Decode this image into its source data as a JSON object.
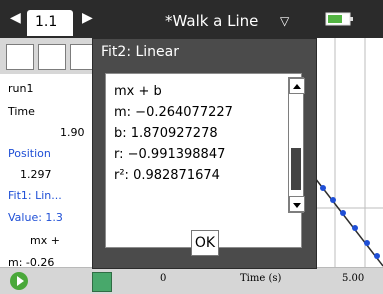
{
  "app": {
    "tab_label": "1.1",
    "title": "*Walk a Line"
  },
  "left_panel": {
    "run": "run1",
    "time_label": "Time",
    "time_value": "1.90",
    "position_label": "Position",
    "position_value": "1.297",
    "fit_label": "Fit1: Lin...",
    "value_line": "Value: 1.3",
    "equation_short": "mx +",
    "m_short": "m: -0.26"
  },
  "dialog": {
    "title": "Fit2: Linear",
    "lines": [
      "mx + b",
      "m: −0.264077227",
      "b: 1.870927278",
      "r: −0.991398847",
      "r²: 0.982871674"
    ],
    "ok_label": "OK"
  },
  "axis": {
    "x_min_label": "0",
    "x_label": "Time (s)",
    "x_max_label": "5.00"
  }
}
